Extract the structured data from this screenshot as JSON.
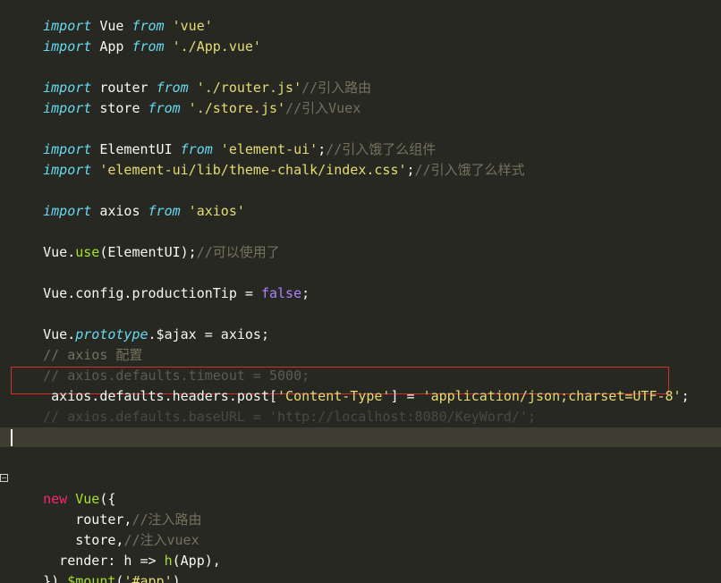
{
  "editor": {
    "lines": {
      "l1": {
        "kw": "import",
        "name": " Vue ",
        "kw2": "from",
        "str": " 'vue'"
      },
      "l2": {
        "kw": "import",
        "name": " App ",
        "kw2": "from",
        "str": " './App.vue'"
      },
      "l3": {
        "kw": "import",
        "name": " router ",
        "kw2": "from",
        "str": " './router.js'",
        "cm": "//引入路由"
      },
      "l4": {
        "kw": "import",
        "name": " store ",
        "kw2": "from",
        "str": " './store.js'",
        "cm": "//引入Vuex"
      },
      "l5": {
        "kw": "import",
        "name": " ElementUI ",
        "kw2": "from",
        "str": " 'element-ui'",
        "punct": ";",
        "cm": "//引入饿了么组件"
      },
      "l6": {
        "kw": "import",
        "str": " 'element-ui/lib/theme-chalk/index.css'",
        "punct": ";",
        "cm": "//引入饿了么样式"
      },
      "l7": {
        "kw": "import",
        "name": " axios ",
        "kw2": "from",
        "str": " 'axios'"
      },
      "l8": {
        "obj": "Vue.",
        "fn": "use",
        "rest": "(ElementUI);",
        "cm": "//可以使用了"
      },
      "l9": {
        "pre": "Vue.config.productionTip = ",
        "bool": "false",
        "post": ";"
      },
      "l10": {
        "obj": "Vue.",
        "proto": "prototype",
        "rest": ".$ajax = axios;"
      },
      "l11": {
        "cm": "// axios 配置"
      },
      "l12": {
        "cm": "// axios.defaults.timeout = 5000;"
      },
      "l13": {
        "pre": " axios.defaults.headers.post[",
        "str1": "'Content-Type'",
        "mid": "] = ",
        "str2": "'application/json;charset=UTF-8'",
        "post": ";"
      },
      "l14": {
        "cm": "// axios.defaults.baseURL = 'http://localhost:8080/KeyWord/';"
      },
      "l15": {
        "kw": "new",
        "fn": " Vue",
        "rest": "({"
      },
      "l16": {
        "pre": "    router,",
        "cm": "//注入路由"
      },
      "l17": {
        "pre": "    store,",
        "cm": "//注入vuex"
      },
      "l18": {
        "pre": "  render: h => ",
        "fn": "h",
        "rest": "(App),"
      },
      "l19": {
        "pre": "}).",
        "fn": "$mount",
        "rest": "(",
        "str": "'#app'",
        "post": ")"
      }
    },
    "fold_glyph": "−"
  }
}
